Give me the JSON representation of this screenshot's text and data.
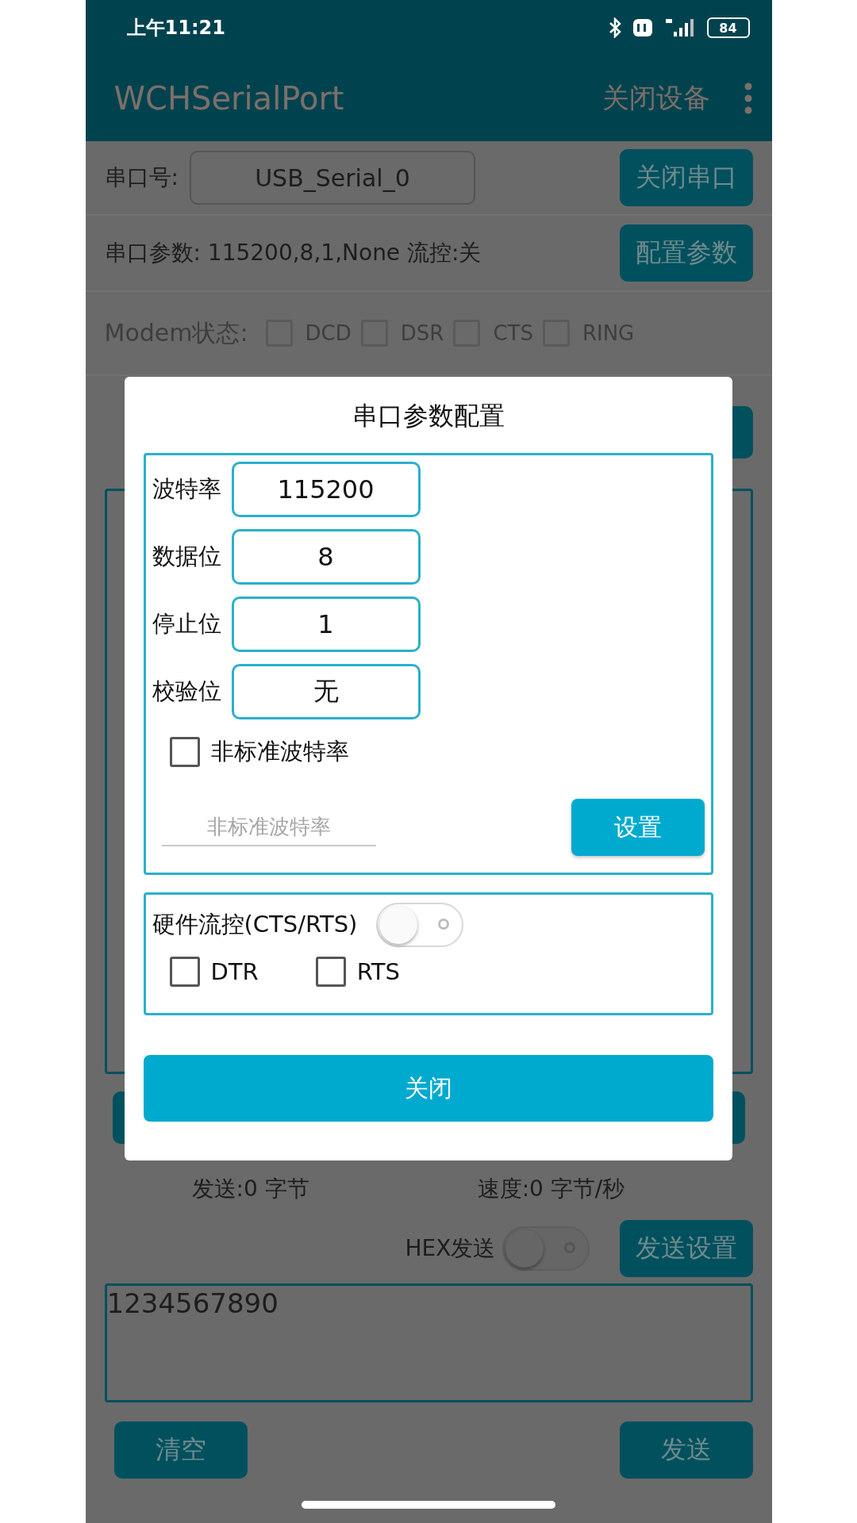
{
  "status_bar": {
    "time": "上午11:21",
    "battery": "84"
  },
  "app_bar": {
    "title": "WCHSerialPort",
    "action": "关闭设备"
  },
  "port_row": {
    "label": "串口号:",
    "value": "USB_Serial_0",
    "button": "关闭串口"
  },
  "params_row": {
    "text": "串口参数: 115200,8,1,None 流控:关",
    "button": "配置参数"
  },
  "modem": {
    "label": "Modem状态:",
    "signals": [
      {
        "label": "DCD",
        "checked": false
      },
      {
        "label": "DSR",
        "checked": false
      },
      {
        "label": "CTS",
        "checked": false
      },
      {
        "label": "RING",
        "checked": false
      }
    ]
  },
  "dialog": {
    "title": "串口参数配置",
    "fields": [
      {
        "label": "波特率",
        "value": "115200"
      },
      {
        "label": "数据位",
        "value": "8"
      },
      {
        "label": "停止位",
        "value": "1"
      },
      {
        "label": "校验位",
        "value": "无"
      }
    ],
    "custom_baud": {
      "label": "非标准波特率",
      "checked": false,
      "placeholder": "非标准波特率",
      "button": "设置"
    },
    "flow_control": {
      "label": "硬件流控(CTS/RTS)",
      "on": false
    },
    "lines": [
      {
        "label": "DTR",
        "checked": false
      },
      {
        "label": "RTS",
        "checked": false
      }
    ],
    "close_button": "关闭"
  },
  "stats": {
    "sent": "发送:0 字节",
    "speed": "速度:0 字节/秒"
  },
  "send": {
    "hex_label": "HEX发送",
    "hex_on": false,
    "settings_button": "发送设置",
    "text": "1234567890",
    "clear_button": "清空",
    "send_button": "发送"
  }
}
